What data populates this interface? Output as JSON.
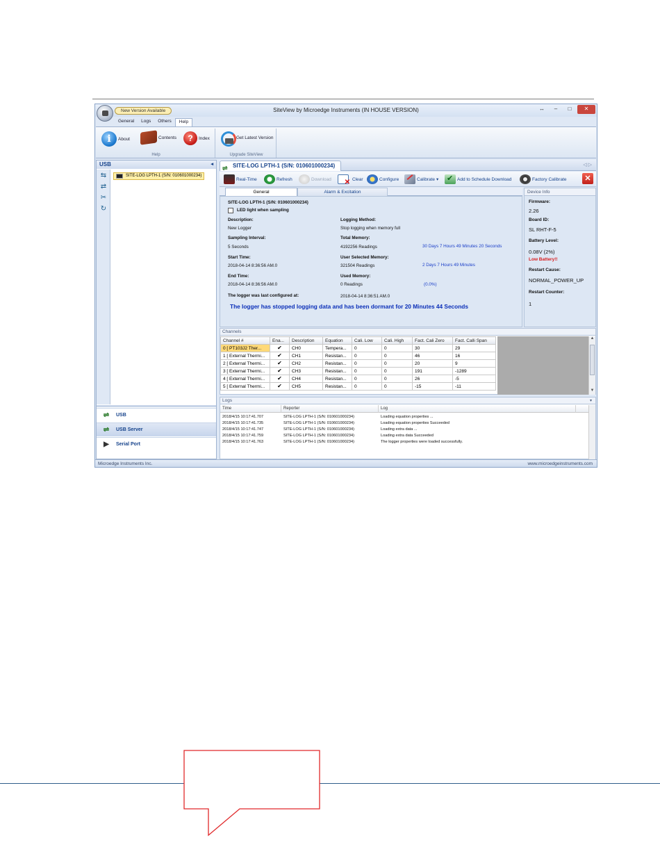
{
  "window": {
    "title": "SiteView by Microedge Instruments (IN HOUSE VERSION)",
    "new_version_badge": "New Version Available",
    "restore_glyph": "↔",
    "minimize_glyph": "–",
    "maximize_glyph": "□",
    "close_glyph": "✕"
  },
  "ribbon": {
    "tabs": [
      "General",
      "Logs",
      "Others",
      "Help"
    ],
    "active_tab": "Help",
    "groups": [
      {
        "label": "Help",
        "items": [
          "About",
          "Contents",
          "Index"
        ]
      },
      {
        "label": "Upgrade SiteView",
        "items": [
          "Get Latest Version"
        ]
      }
    ],
    "icons": {
      "about": "info-icon",
      "contents": "book-icon",
      "index": "help-icon",
      "upgrade": "upgrade-icon"
    }
  },
  "left_pane": {
    "header": "USB",
    "collapse_glyph": "◂",
    "device_item": "SITE-LOG LPTH-1 (S/N: 010601000234)",
    "strip_icons": [
      "connect-icon",
      "disconnect-icon",
      "tools-icon",
      "refresh-icon"
    ],
    "strip_glyphs": [
      "⇆",
      "⇄",
      "✂",
      "↻"
    ],
    "nav": [
      {
        "label": "USB",
        "icon": "usb-icon",
        "glyph": "⇌"
      },
      {
        "label": "USB Server",
        "icon": "usb-server-icon",
        "glyph": "⇌"
      },
      {
        "label": "Serial Port",
        "icon": "serial-port-icon",
        "glyph": "▶"
      }
    ],
    "selected_nav": "USB Server"
  },
  "document": {
    "tab_title": "SITE-LOG LPTH-1 (S/N: 010601000234)",
    "usb_glyph": "⇌",
    "tab_nav": "◁ ▷",
    "toolbar": {
      "realtime": "Real-Time",
      "refresh": "Refresh",
      "download": "Download",
      "clear": "Clear",
      "configure": "Configure",
      "calibrate": "Calibrate",
      "calibrate_arrow": "▾",
      "schedule": "Add to Schedule Download",
      "factory": "Factory Calibrate",
      "close_glyph": "✕"
    },
    "subtabs": [
      "General",
      "Alarm & Excitation"
    ],
    "general": {
      "device_title": "SITE-LOG LPTH-1 (S/N: 010601000234)",
      "led_label": "LED light when sampling",
      "description_label": "Description:",
      "description_value": "New Logger",
      "logging_method_label": "Logging Method:",
      "logging_method_value": "Stop logging when memory full",
      "sampling_label": "Sampling Interval:",
      "sampling_value": "5 Seconds",
      "total_memory_label": "Total Memory:",
      "total_memory_value": "4192256 Readings",
      "total_memory_duration": "30 Days 7 Hours 49 Minutes 20 Seconds",
      "start_time_label": "Start Time:",
      "start_time_value": "2018-04-14 8:36:56 AM.0",
      "user_memory_label": "User Selected Memory:",
      "user_memory_value": "321504 Readings",
      "user_memory_duration": "2 Days 7 Hours 49 Minutes",
      "end_time_label": "End Time:",
      "end_time_value": "2018-04-14 8:36:56 AM.0",
      "used_memory_label": "Used Memory:",
      "used_memory_value": "0 Readings",
      "used_memory_pct": "(0.0%)",
      "last_config_label": "The logger was last configured at:",
      "last_config_value": "2018-04-14 8:36:51 AM.0",
      "status_message": "The logger has stopped logging data and has been dormant for  20 Minutes 44 Seconds"
    },
    "device_info": {
      "header": "Device Info",
      "firmware_label": "Firmware:",
      "firmware_value": "2.26",
      "board_label": "Board ID:",
      "board_value": "SL RHT-F-5",
      "battery_label": "Battery Level:",
      "battery_value": "0.08V (2%)",
      "battery_warning": "Low Battery!!",
      "restart_cause_label": "Restart Cause:",
      "restart_cause_value": "NORMAL_POWER_UP",
      "restart_counter_label": "Restart Counter:",
      "restart_counter_value": "1"
    },
    "channels": {
      "header": "Channels",
      "columns": [
        "Channel #",
        "Ena...",
        "Description",
        "Equation",
        "Cali. Low",
        "Cali. High",
        "Fact. Cali Zero",
        "Fact. Calli Span"
      ],
      "check_glyph": "✔",
      "rows": [
        [
          "0 [ PT103J2 Ther...",
          "✔",
          "CH0",
          "Tempera...",
          "0",
          "0",
          "30",
          "29"
        ],
        [
          "1 [ External Thermi...",
          "✔",
          "CH1",
          "Resistan...",
          "0",
          "0",
          "46",
          "16"
        ],
        [
          "2 [ External Thermi...",
          "✔",
          "CH2",
          "Resistan...",
          "0",
          "0",
          "20",
          "9"
        ],
        [
          "3 [ External Thermi...",
          "✔",
          "CH3",
          "Resistan...",
          "0",
          "0",
          "191",
          "-1289"
        ],
        [
          "4 [ External Thermi...",
          "✔",
          "CH4",
          "Resistan...",
          "0",
          "0",
          "26",
          "-5"
        ],
        [
          "5 [ External Thermi...",
          "✔",
          "CH5",
          "Resistan...",
          "0",
          "0",
          "-15",
          "-11"
        ]
      ]
    },
    "logs": {
      "header": "Logs",
      "pin_glyph": "▾",
      "columns": [
        "Time",
        "Reporter",
        "Log"
      ],
      "rows": [
        [
          "2018/4/15 10:17:41.707",
          "SITE-LOG LPTH-1 (S/N: 010601000234)",
          "Loading equation properties ..."
        ],
        [
          "2018/4/15 10:17:41.735",
          "SITE-LOG LPTH-1 (S/N: 010601000234)",
          "Loading equation properties Succeeded"
        ],
        [
          "2018/4/15 10:17:41.747",
          "SITE-LOG LPTH-1 (S/N: 010601000234)",
          "Loading extra data ..."
        ],
        [
          "2018/4/15 10:17:41.759",
          "SITE-LOG LPTH-1 (S/N: 010601000234)",
          "Loading extra data Succeeded"
        ],
        [
          "2018/4/15 10:17:41.763",
          "SITE-LOG LPTH-1 (S/N: 010601000234)",
          "The logger properties were loaded successfully."
        ]
      ]
    }
  },
  "statusbar": {
    "company": "Microedge Instruments Inc.",
    "website": "www.microedgeinstruments.com"
  },
  "colors": {
    "ribbon_blue": "#dfe8f5",
    "selection_yellow": "#ffd978",
    "status_blue": "#0b2fb8",
    "warning_red": "#d91a1a",
    "callout_red": "#e0282a"
  }
}
